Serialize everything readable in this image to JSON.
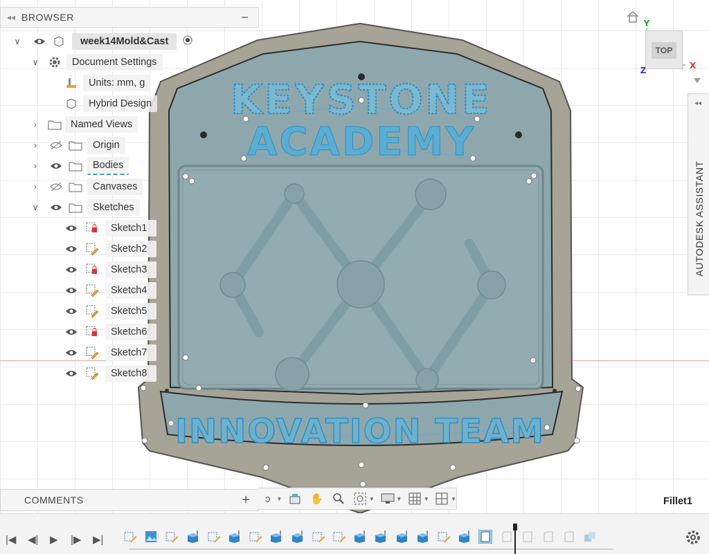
{
  "browser": {
    "title": "BROWSER",
    "root": "week14Mold&Cast",
    "document_settings": "Document Settings",
    "units": "Units: mm, g",
    "hybrid_design": "Hybrid Design",
    "folders": [
      "Named Views",
      "Origin",
      "Bodies",
      "Canvases",
      "Sketches"
    ],
    "sketches": [
      "Sketch1",
      "Sketch2",
      "Sketch3",
      "Sketch4",
      "Sketch5",
      "Sketch6",
      "Sketch7",
      "Sketch8"
    ]
  },
  "model": {
    "line1": "KEYSTONE",
    "line2": "ACADEMY",
    "line3": "INNOVATION TEAM"
  },
  "view_cube": {
    "face": "TOP",
    "axis_y": "Y",
    "axis_x": "X",
    "axis_z": "Z"
  },
  "assistant": {
    "label": "AUTODESK ASSISTANT"
  },
  "comments": {
    "title": "COMMENTS",
    "add": "+"
  },
  "status": {
    "feature": "Fillet1"
  },
  "icons": {
    "home": "home-icon",
    "eye": "eye-icon",
    "eye_hidden": "eye-hidden-icon",
    "folder": "folder-icon",
    "gear": "gear-icon",
    "sketch": "sketch-icon"
  },
  "colors": {
    "model_face": "#8ea7ad",
    "model_rim": "#9e9c92",
    "selection": "#5aaed3",
    "axis_red": "#d33",
    "axis_green": "#2a2",
    "axis_blue": "#33d"
  }
}
